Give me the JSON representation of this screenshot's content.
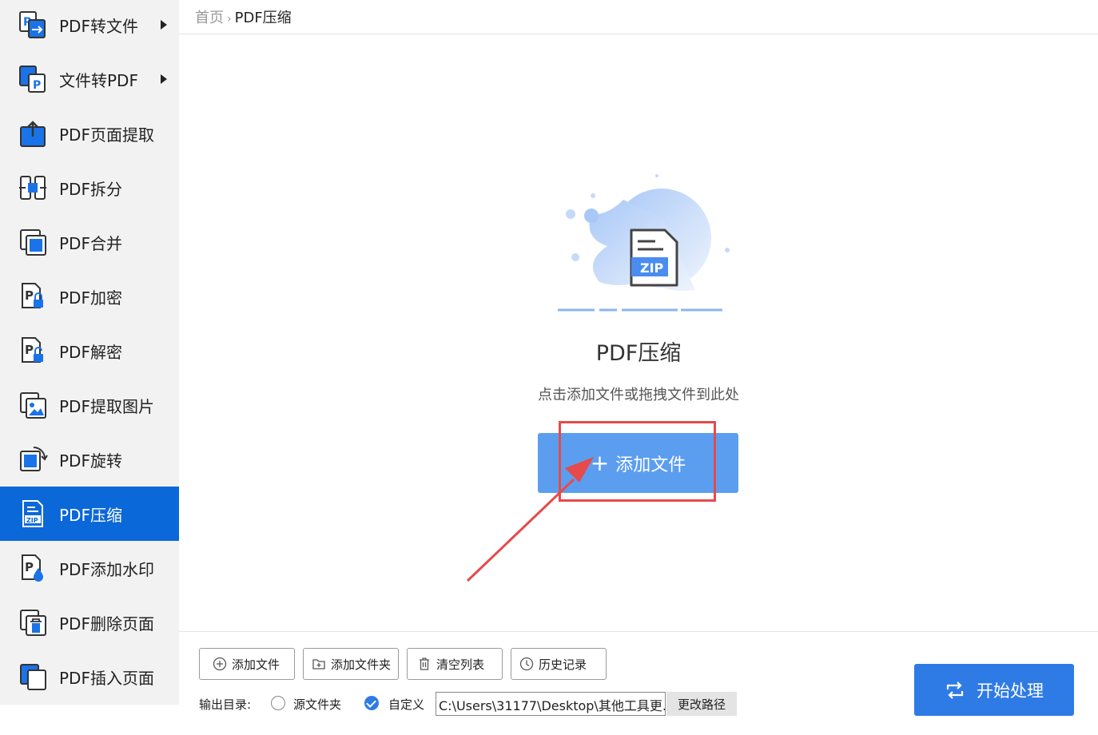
{
  "breadcrumb": {
    "home": "首页",
    "separator": "›",
    "current": "PDF压缩"
  },
  "sidebar": {
    "items": [
      {
        "label": "PDF转文件",
        "icon": "pdf-to-file-icon",
        "has_submenu": true
      },
      {
        "label": "文件转PDF",
        "icon": "file-to-pdf-icon",
        "has_submenu": true
      },
      {
        "label": "PDF页面提取",
        "icon": "page-extract-icon",
        "has_submenu": false
      },
      {
        "label": "PDF拆分",
        "icon": "split-icon",
        "has_submenu": false
      },
      {
        "label": "PDF合并",
        "icon": "merge-icon",
        "has_submenu": false
      },
      {
        "label": "PDF加密",
        "icon": "lock-icon",
        "has_submenu": false
      },
      {
        "label": "PDF解密",
        "icon": "unlock-icon",
        "has_submenu": false
      },
      {
        "label": "PDF提取图片",
        "icon": "image-extract-icon",
        "has_submenu": false
      },
      {
        "label": "PDF旋转",
        "icon": "rotate-icon",
        "has_submenu": false
      },
      {
        "label": "PDF压缩",
        "icon": "zip-icon",
        "has_submenu": false,
        "active": true
      },
      {
        "label": "PDF添加水印",
        "icon": "watermark-icon",
        "has_submenu": false
      },
      {
        "label": "PDF删除页面",
        "icon": "delete-page-icon",
        "has_submenu": false
      },
      {
        "label": "PDF插入页面",
        "icon": "insert-page-icon",
        "has_submenu": false
      }
    ]
  },
  "dropzone": {
    "illustration_icon": "zip-file-icon",
    "zip_text": "ZIP",
    "title": "PDF压缩",
    "hint": "点击添加文件或拖拽文件到此处",
    "add_button_plus": "+",
    "add_button_label": "添加文件"
  },
  "toolbar": {
    "add_file": "添加文件",
    "add_folder": "添加文件夹",
    "clear_list": "清空列表",
    "history": "历史记录"
  },
  "output": {
    "label": "输出目录:",
    "option_source": "源文件夹",
    "option_custom": "自定义",
    "selected": "自定义",
    "path": "C:\\Users\\31177\\Desktop\\其他工具更...",
    "change_path": "更改路径"
  },
  "start_button": "开始处理",
  "colors": {
    "active_sidebar": "#0b68d8",
    "add_button": "#5b9ef0",
    "start_button": "#2f7be6",
    "annotation": "#e64a4a"
  }
}
